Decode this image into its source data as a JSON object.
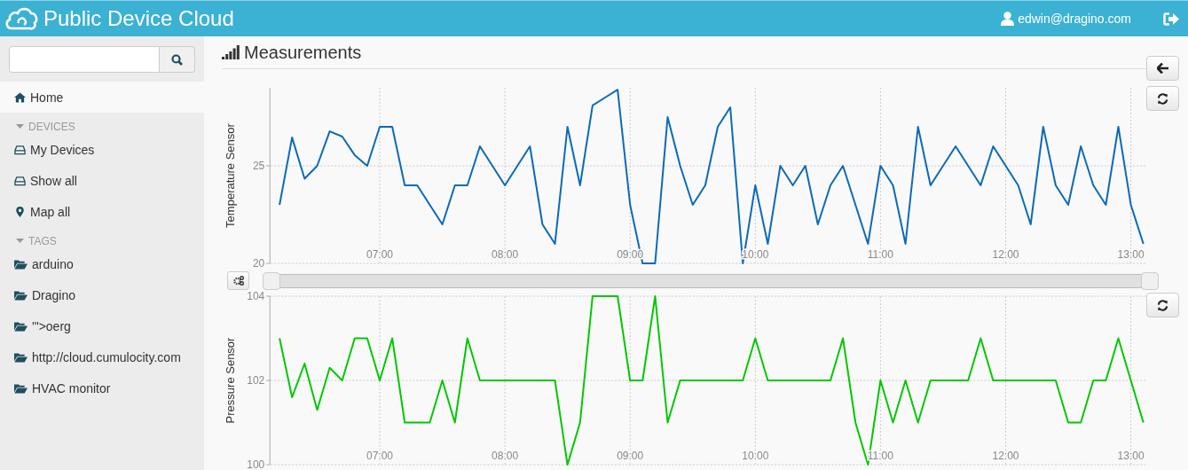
{
  "header": {
    "title": "Public Device Cloud",
    "user": "edwin@dragino.com"
  },
  "sidebar": {
    "items": [
      {
        "kind": "home",
        "label": "Home",
        "selected": true
      },
      {
        "kind": "header",
        "label": "DEVICES"
      },
      {
        "kind": "device",
        "label": "My Devices",
        "selected": false
      },
      {
        "kind": "device",
        "label": "Show all",
        "selected": false
      },
      {
        "kind": "map",
        "label": "Map all",
        "selected": false
      },
      {
        "kind": "header",
        "label": "TAGS"
      },
      {
        "kind": "tag",
        "label": "arduino",
        "selected": false
      },
      {
        "kind": "tag",
        "label": "Dragino",
        "selected": false
      },
      {
        "kind": "tag",
        "label": "'\">oerg",
        "selected": false
      },
      {
        "kind": "tag",
        "label": "http://cloud.cumulocity.com",
        "selected": false
      },
      {
        "kind": "tag",
        "label": "HVAC monitor",
        "selected": false
      }
    ]
  },
  "page": {
    "title": "Measurements"
  },
  "charts": [
    {
      "chart_data": {
        "type": "line",
        "ylabel": "Temperature Sensor",
        "x": [
          6.2,
          6.3,
          6.4,
          6.5,
          6.6,
          6.7,
          6.8,
          6.9,
          7,
          7.1,
          7.2,
          7.3,
          7.4,
          7.5,
          7.6,
          7.7,
          7.8,
          7.9,
          8,
          8.1,
          8.2,
          8.3,
          8.4,
          8.5,
          8.6,
          8.7,
          8.8,
          8.9,
          9,
          9.1,
          9.2,
          9.3,
          9.4,
          9.5,
          9.6,
          9.7,
          9.8,
          9.9,
          10,
          10.1,
          10.2,
          10.3,
          10.4,
          10.5,
          10.6,
          10.7,
          10.8,
          10.9,
          11,
          11.1,
          11.2,
          11.3,
          11.4,
          11.5,
          11.6,
          11.7,
          11.8,
          11.9,
          12,
          12.1,
          12.2,
          12.3,
          12.4,
          12.5,
          12.6,
          12.7,
          12.8,
          12.9,
          13,
          13.1
        ],
        "series": [
          {
            "color": "#0c6ab8",
            "values": [
              23,
              26.45,
              24.34,
              25,
              26.77,
              26.5,
              25.55,
              25,
              27,
              27,
              24,
              24,
              23,
              22,
              24,
              24,
              26,
              25,
              24,
              25,
              26,
              22,
              21,
              27,
              24,
              28.1,
              28.5,
              28.9,
              23,
              20,
              20,
              27.5,
              25,
              23,
              24,
              27,
              28,
              20,
              24,
              21,
              25,
              24,
              25,
              22,
              24,
              25,
              23,
              21,
              25,
              24,
              21,
              27,
              24,
              25,
              26,
              25,
              24,
              26,
              25,
              24,
              22,
              27,
              24,
              23,
              26,
              24,
              23,
              27,
              23,
              21
            ]
          }
        ],
        "xlim": [
          6.13,
          13.13
        ],
        "ylim": [
          20,
          29
        ],
        "xticks": [
          {
            "value": 7,
            "label": "07:00"
          },
          {
            "value": 8,
            "label": "08:00"
          },
          {
            "value": 9,
            "label": "09:00"
          },
          {
            "value": 10,
            "label": "10:00"
          },
          {
            "value": 11,
            "label": "11:00"
          },
          {
            "value": 12,
            "label": "12:00"
          },
          {
            "value": 13,
            "label": "13:00"
          }
        ],
        "yticks": [
          20,
          25
        ],
        "grid": true
      }
    },
    {
      "chart_data": {
        "type": "line",
        "ylabel": "Pressure Sensor",
        "x": [
          6.2,
          6.3,
          6.4,
          6.5,
          6.6,
          6.7,
          6.8,
          6.9,
          7,
          7.1,
          7.2,
          7.3,
          7.4,
          7.5,
          7.6,
          7.7,
          7.8,
          7.9,
          8,
          8.1,
          8.2,
          8.3,
          8.4,
          8.5,
          8.6,
          8.7,
          8.8,
          8.9,
          9,
          9.1,
          9.2,
          9.3,
          9.4,
          9.5,
          9.6,
          9.7,
          9.8,
          9.9,
          10,
          10.1,
          10.2,
          10.3,
          10.4,
          10.5,
          10.6,
          10.7,
          10.8,
          10.9,
          11,
          11.1,
          11.2,
          11.3,
          11.4,
          11.5,
          11.6,
          11.7,
          11.8,
          11.9,
          12,
          12.1,
          12.2,
          12.3,
          12.4,
          12.5,
          12.6,
          12.7,
          12.8,
          12.9,
          13,
          13.1
        ],
        "series": [
          {
            "color": "#00c800",
            "values": [
              103,
              101.6,
              102.4,
              101.3,
              102.3,
              102,
              103,
              103,
              102,
              103,
              101,
              101,
              101,
              102,
              101,
              103,
              102,
              102,
              102,
              102,
              102,
              102,
              102,
              100,
              101,
              104,
              104,
              104,
              102,
              102,
              104,
              101,
              102,
              102,
              102,
              102,
              102,
              102,
              103,
              102,
              102,
              102,
              102,
              102,
              102,
              103,
              101,
              100,
              102,
              101,
              102,
              101,
              102,
              102,
              102,
              102,
              103,
              102,
              102,
              102,
              102,
              102,
              102,
              101,
              101,
              102,
              102,
              103,
              102,
              101
            ]
          }
        ],
        "xlim": [
          6.13,
          13.13
        ],
        "ylim": [
          100,
          104
        ],
        "xticks": [
          {
            "value": 7,
            "label": "07:00"
          },
          {
            "value": 8,
            "label": "08:00"
          },
          {
            "value": 9,
            "label": "09:00"
          },
          {
            "value": 10,
            "label": "10:00"
          },
          {
            "value": 11,
            "label": "11:00"
          },
          {
            "value": 12,
            "label": "12:00"
          },
          {
            "value": 13,
            "label": "13:00"
          }
        ],
        "yticks": [
          100,
          102,
          104
        ],
        "grid": true
      }
    }
  ],
  "slider": {
    "start": {
      "level": 0
    },
    "end": {
      "level": 1
    }
  }
}
